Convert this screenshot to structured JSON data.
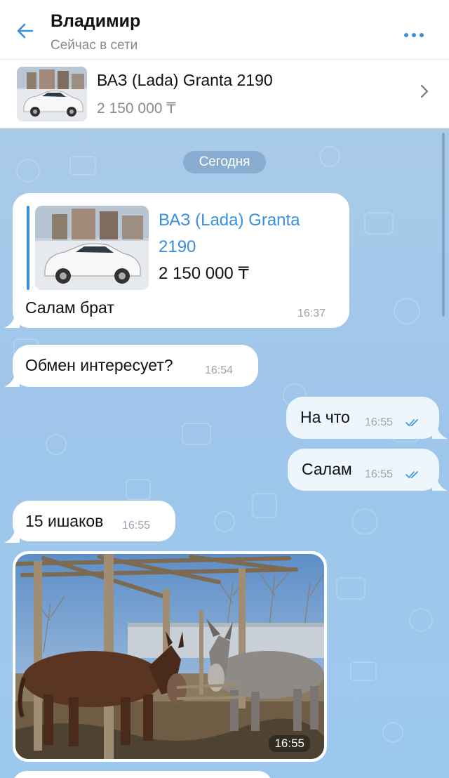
{
  "header": {
    "name": "Владимир",
    "status": "Сейчас в сети"
  },
  "listing": {
    "title": "ВАЗ (Lada) Granta 2190",
    "price": "2 150 000 ₸"
  },
  "chat": {
    "date_separator": "Сегодня",
    "messages": [
      {
        "direction": "in",
        "forwarded_listing": {
          "title": "ВАЗ (Lada) Granta 2190",
          "price": "2 150 000 ₸"
        },
        "text": "Салам брат",
        "time": "16:37"
      },
      {
        "direction": "in",
        "text": "Обмен интересует?",
        "time": "16:54"
      },
      {
        "direction": "out",
        "text": "На что",
        "time": "16:55",
        "read": true
      },
      {
        "direction": "out",
        "text": "Салам",
        "time": "16:55",
        "read": true
      },
      {
        "direction": "in",
        "text": "15 ишаков",
        "time": "16:55"
      },
      {
        "direction": "in",
        "type": "photo",
        "time": "16:55"
      }
    ]
  },
  "colors": {
    "accent": "#3a8fd9",
    "chat_background": "#a9cbe8",
    "incoming_bubble": "#ffffff",
    "outgoing_bubble": "#eef6fd"
  },
  "icons": {
    "back": "arrow-left-icon",
    "more": "more-dots-icon",
    "chevron": "chevron-right-icon",
    "read": "double-check-icon"
  }
}
